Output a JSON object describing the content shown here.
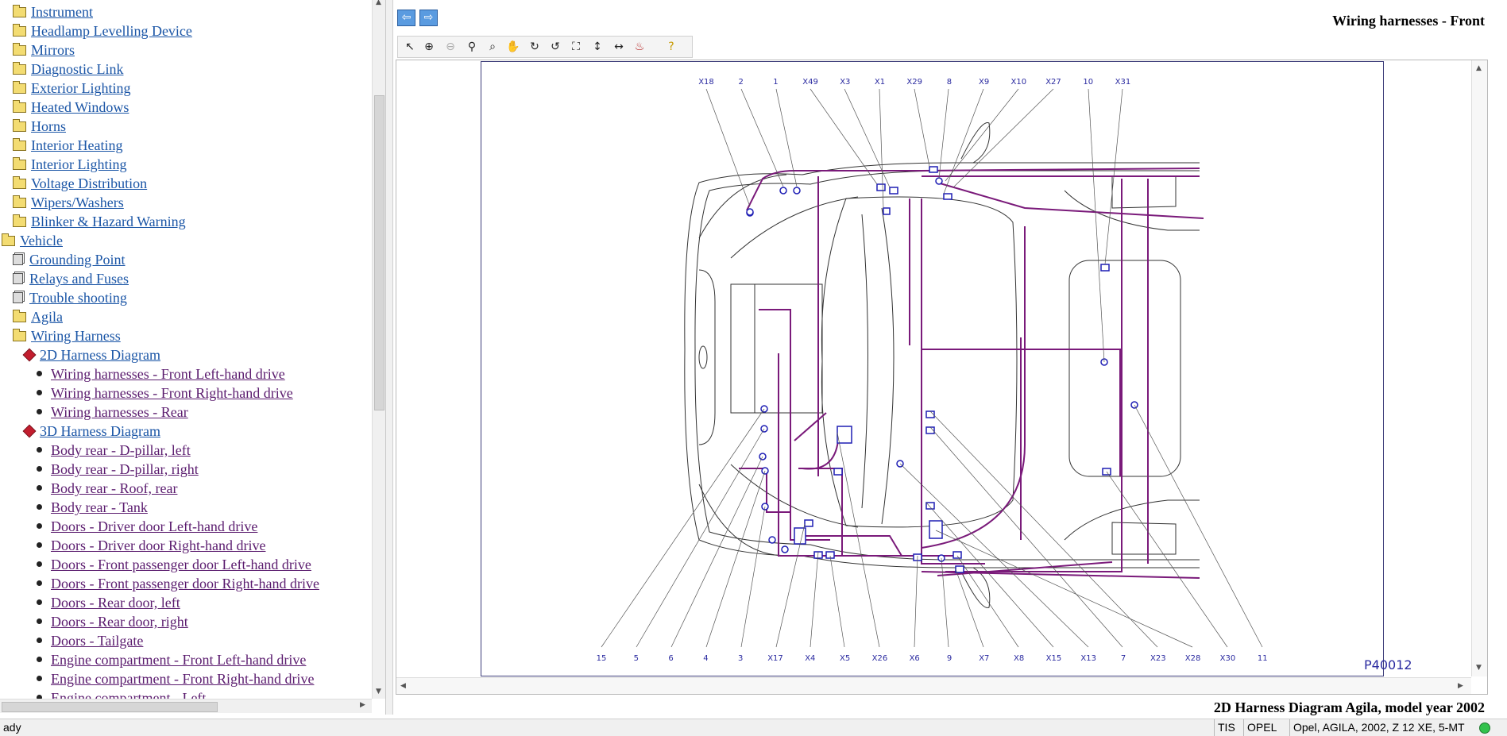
{
  "tree": {
    "items": [
      {
        "label": "Instrument",
        "kind": "folder",
        "level": 1
      },
      {
        "label": "Headlamp Levelling Device",
        "kind": "folder",
        "level": 1
      },
      {
        "label": "Mirrors",
        "kind": "folder",
        "level": 1
      },
      {
        "label": "Diagnostic Link",
        "kind": "folder",
        "level": 1
      },
      {
        "label": "Exterior Lighting",
        "kind": "folder",
        "level": 1
      },
      {
        "label": "Heated Windows",
        "kind": "folder",
        "level": 1
      },
      {
        "label": "Horns",
        "kind": "folder",
        "level": 1
      },
      {
        "label": "Interior Heating",
        "kind": "folder",
        "level": 1
      },
      {
        "label": "Interior Lighting",
        "kind": "folder",
        "level": 1
      },
      {
        "label": "Voltage Distribution",
        "kind": "folder",
        "level": 1
      },
      {
        "label": "Wipers/Washers",
        "kind": "folder",
        "level": 1
      },
      {
        "label": "Blinker & Hazard Warning",
        "kind": "folder",
        "level": 1
      },
      {
        "label": "Vehicle",
        "kind": "folder",
        "level": 0
      },
      {
        "label": "Grounding Point",
        "kind": "doc",
        "level": 1
      },
      {
        "label": "Relays and Fuses",
        "kind": "doc",
        "level": 1
      },
      {
        "label": "Trouble shooting",
        "kind": "doc",
        "level": 1
      },
      {
        "label": "Agila",
        "kind": "folder",
        "level": 1
      },
      {
        "label": "Wiring Harness",
        "kind": "folder",
        "level": 1
      },
      {
        "label": "2D Harness Diagram",
        "kind": "harness",
        "level": 2
      },
      {
        "label": "Wiring harnesses - Front Left-hand drive",
        "kind": "leaf",
        "level": 3
      },
      {
        "label": "Wiring harnesses - Front Right-hand drive",
        "kind": "leaf",
        "level": 3
      },
      {
        "label": "Wiring harnesses - Rear",
        "kind": "leaf",
        "level": 3
      },
      {
        "label": "3D Harness Diagram",
        "kind": "harness",
        "level": 2
      },
      {
        "label": "Body rear - D-pillar, left",
        "kind": "leaf",
        "level": 3
      },
      {
        "label": "Body rear - D-pillar, right",
        "kind": "leaf",
        "level": 3
      },
      {
        "label": "Body rear - Roof, rear",
        "kind": "leaf",
        "level": 3
      },
      {
        "label": "Body rear - Tank",
        "kind": "leaf",
        "level": 3
      },
      {
        "label": "Doors - Driver door Left-hand drive",
        "kind": "leaf",
        "level": 3
      },
      {
        "label": "Doors - Driver door Right-hand drive",
        "kind": "leaf",
        "level": 3
      },
      {
        "label": "Doors - Front passenger door Left-hand drive",
        "kind": "leaf",
        "level": 3
      },
      {
        "label": "Doors - Front passenger door Right-hand drive",
        "kind": "leaf",
        "level": 3
      },
      {
        "label": "Doors - Rear door, left",
        "kind": "leaf",
        "level": 3
      },
      {
        "label": "Doors - Rear door, right",
        "kind": "leaf",
        "level": 3
      },
      {
        "label": "Doors - Tailgate",
        "kind": "leaf",
        "level": 3
      },
      {
        "label": "Engine compartment - Front Left-hand drive",
        "kind": "leaf",
        "level": 3
      },
      {
        "label": "Engine compartment - Front Right-hand drive",
        "kind": "leaf",
        "level": 3
      },
      {
        "label": "Engine compartment - Left",
        "kind": "leaf",
        "level": 3
      }
    ]
  },
  "nav": {
    "back_icon": "arrow-left-icon",
    "forward_icon": "arrow-right-icon"
  },
  "document": {
    "title": "Wiring harnesses - Front",
    "footer_title": "2D Harness Diagram Agila, model year 2002"
  },
  "toolbar": {
    "tools": [
      "select-icon",
      "zoom-in-icon",
      "zoom-out-icon",
      "zoom-icon",
      "zoom-window-icon",
      "pan-hand-icon",
      "rotate-cw-icon",
      "rotate-ccw-icon",
      "fit-all-icon",
      "fit-height-icon",
      "fit-width-icon",
      "layers-icon",
      "help-icon"
    ]
  },
  "diagram": {
    "figure_id": "P40012",
    "top_labels": [
      "X18",
      "2",
      "1",
      "X49",
      "X3",
      "X1",
      "X29",
      "8",
      "X9",
      "X10",
      "X27",
      "10",
      "X31"
    ],
    "bottom_labels": [
      "15",
      "5",
      "6",
      "4",
      "3",
      "X17",
      "X4",
      "X5",
      "X26",
      "X6",
      "9",
      "X7",
      "X8",
      "X15",
      "X13",
      "7",
      "X23",
      "X28",
      "X30",
      "11"
    ],
    "harness_color": "#7a1a7a",
    "connector_color": "#1e1eb4"
  },
  "status": {
    "message": "ady",
    "app": "TIS",
    "brand": "OPEL",
    "vehicle": "Opel, AGILA, 2002, Z 12 XE, 5-MT"
  },
  "colors": {
    "category_link": "#1a55a6",
    "visited_link": "#5a1b6e",
    "nav_button": "#5a9be0"
  }
}
